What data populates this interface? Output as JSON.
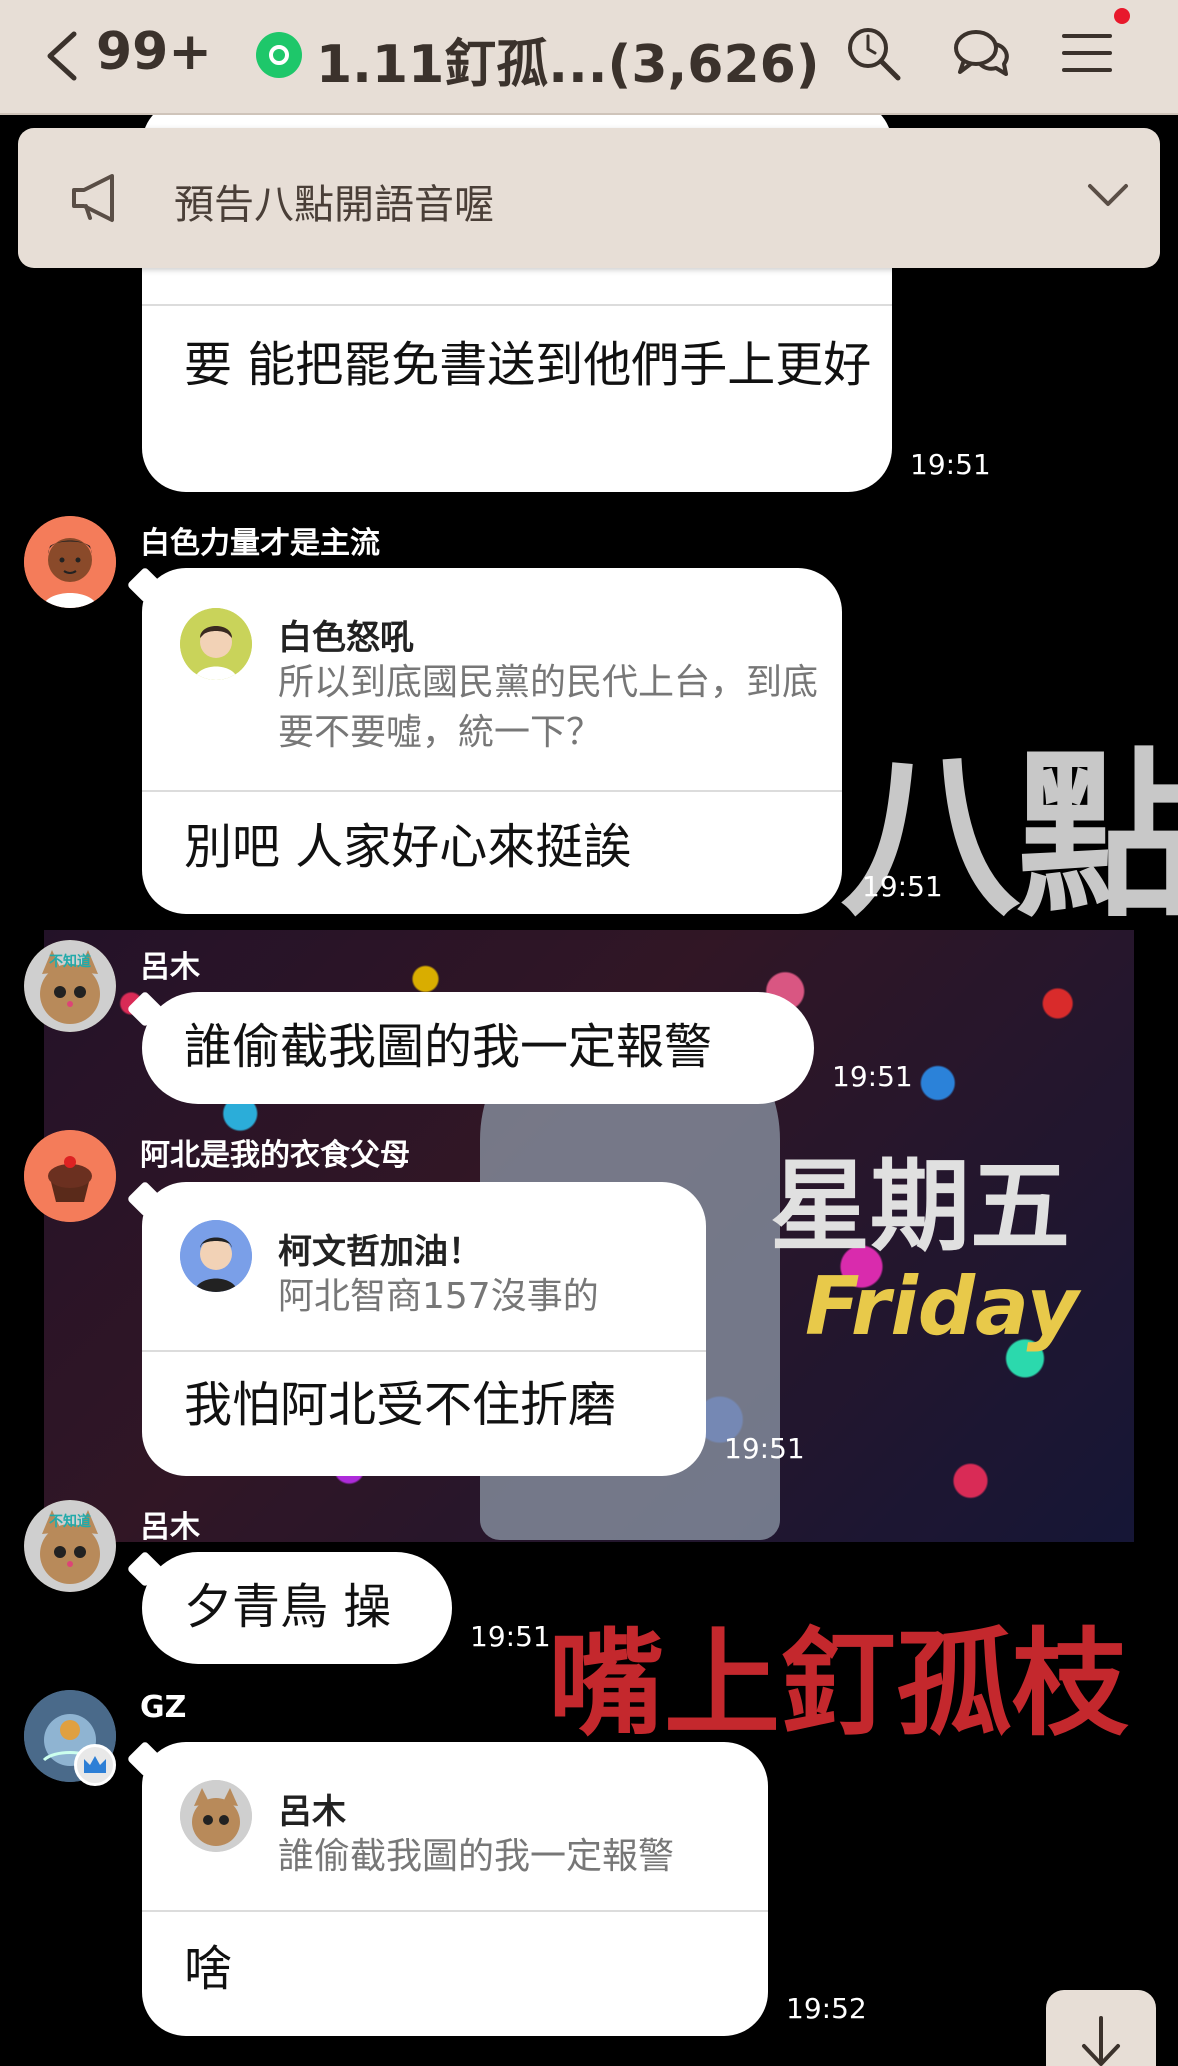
{
  "header": {
    "unread_count": "99+",
    "title": "1.11釘孤...(3,626)",
    "accent": "#1ec76a"
  },
  "announcement": {
    "text": "預告八點開語音喔"
  },
  "background": {
    "text_eight": "八點",
    "text_friday_zh": "星期五",
    "text_friday_en": "Friday",
    "text_mouth": "嘴上釘孤枝"
  },
  "messages": [
    {
      "body": "要 能把罷免書送到他們手上更好",
      "time": "19:51"
    },
    {
      "sender": "白色力量才是主流",
      "reply_name": "白色怒吼",
      "reply_text": "所以到底國民黨的民代上台，到底要不要噓，統一下？",
      "body": "別吧 人家好心來挺誒",
      "time": "19:51"
    },
    {
      "sender": "呂木",
      "body": "誰偷截我圖的我一定報警",
      "time": "19:51"
    },
    {
      "sender": "阿北是我的衣食父母",
      "reply_name": "柯文哲加油！",
      "reply_text": "阿北智商157沒事的",
      "body": "我怕阿北受不住折磨",
      "time": "19:51"
    },
    {
      "sender": "呂木",
      "body": "夕青鳥 操",
      "time": "19:51"
    },
    {
      "sender": "GZ",
      "reply_name": "呂木",
      "reply_text": "誰偷截我圖的我一定報警",
      "body": "啥",
      "time": "19:52"
    }
  ]
}
